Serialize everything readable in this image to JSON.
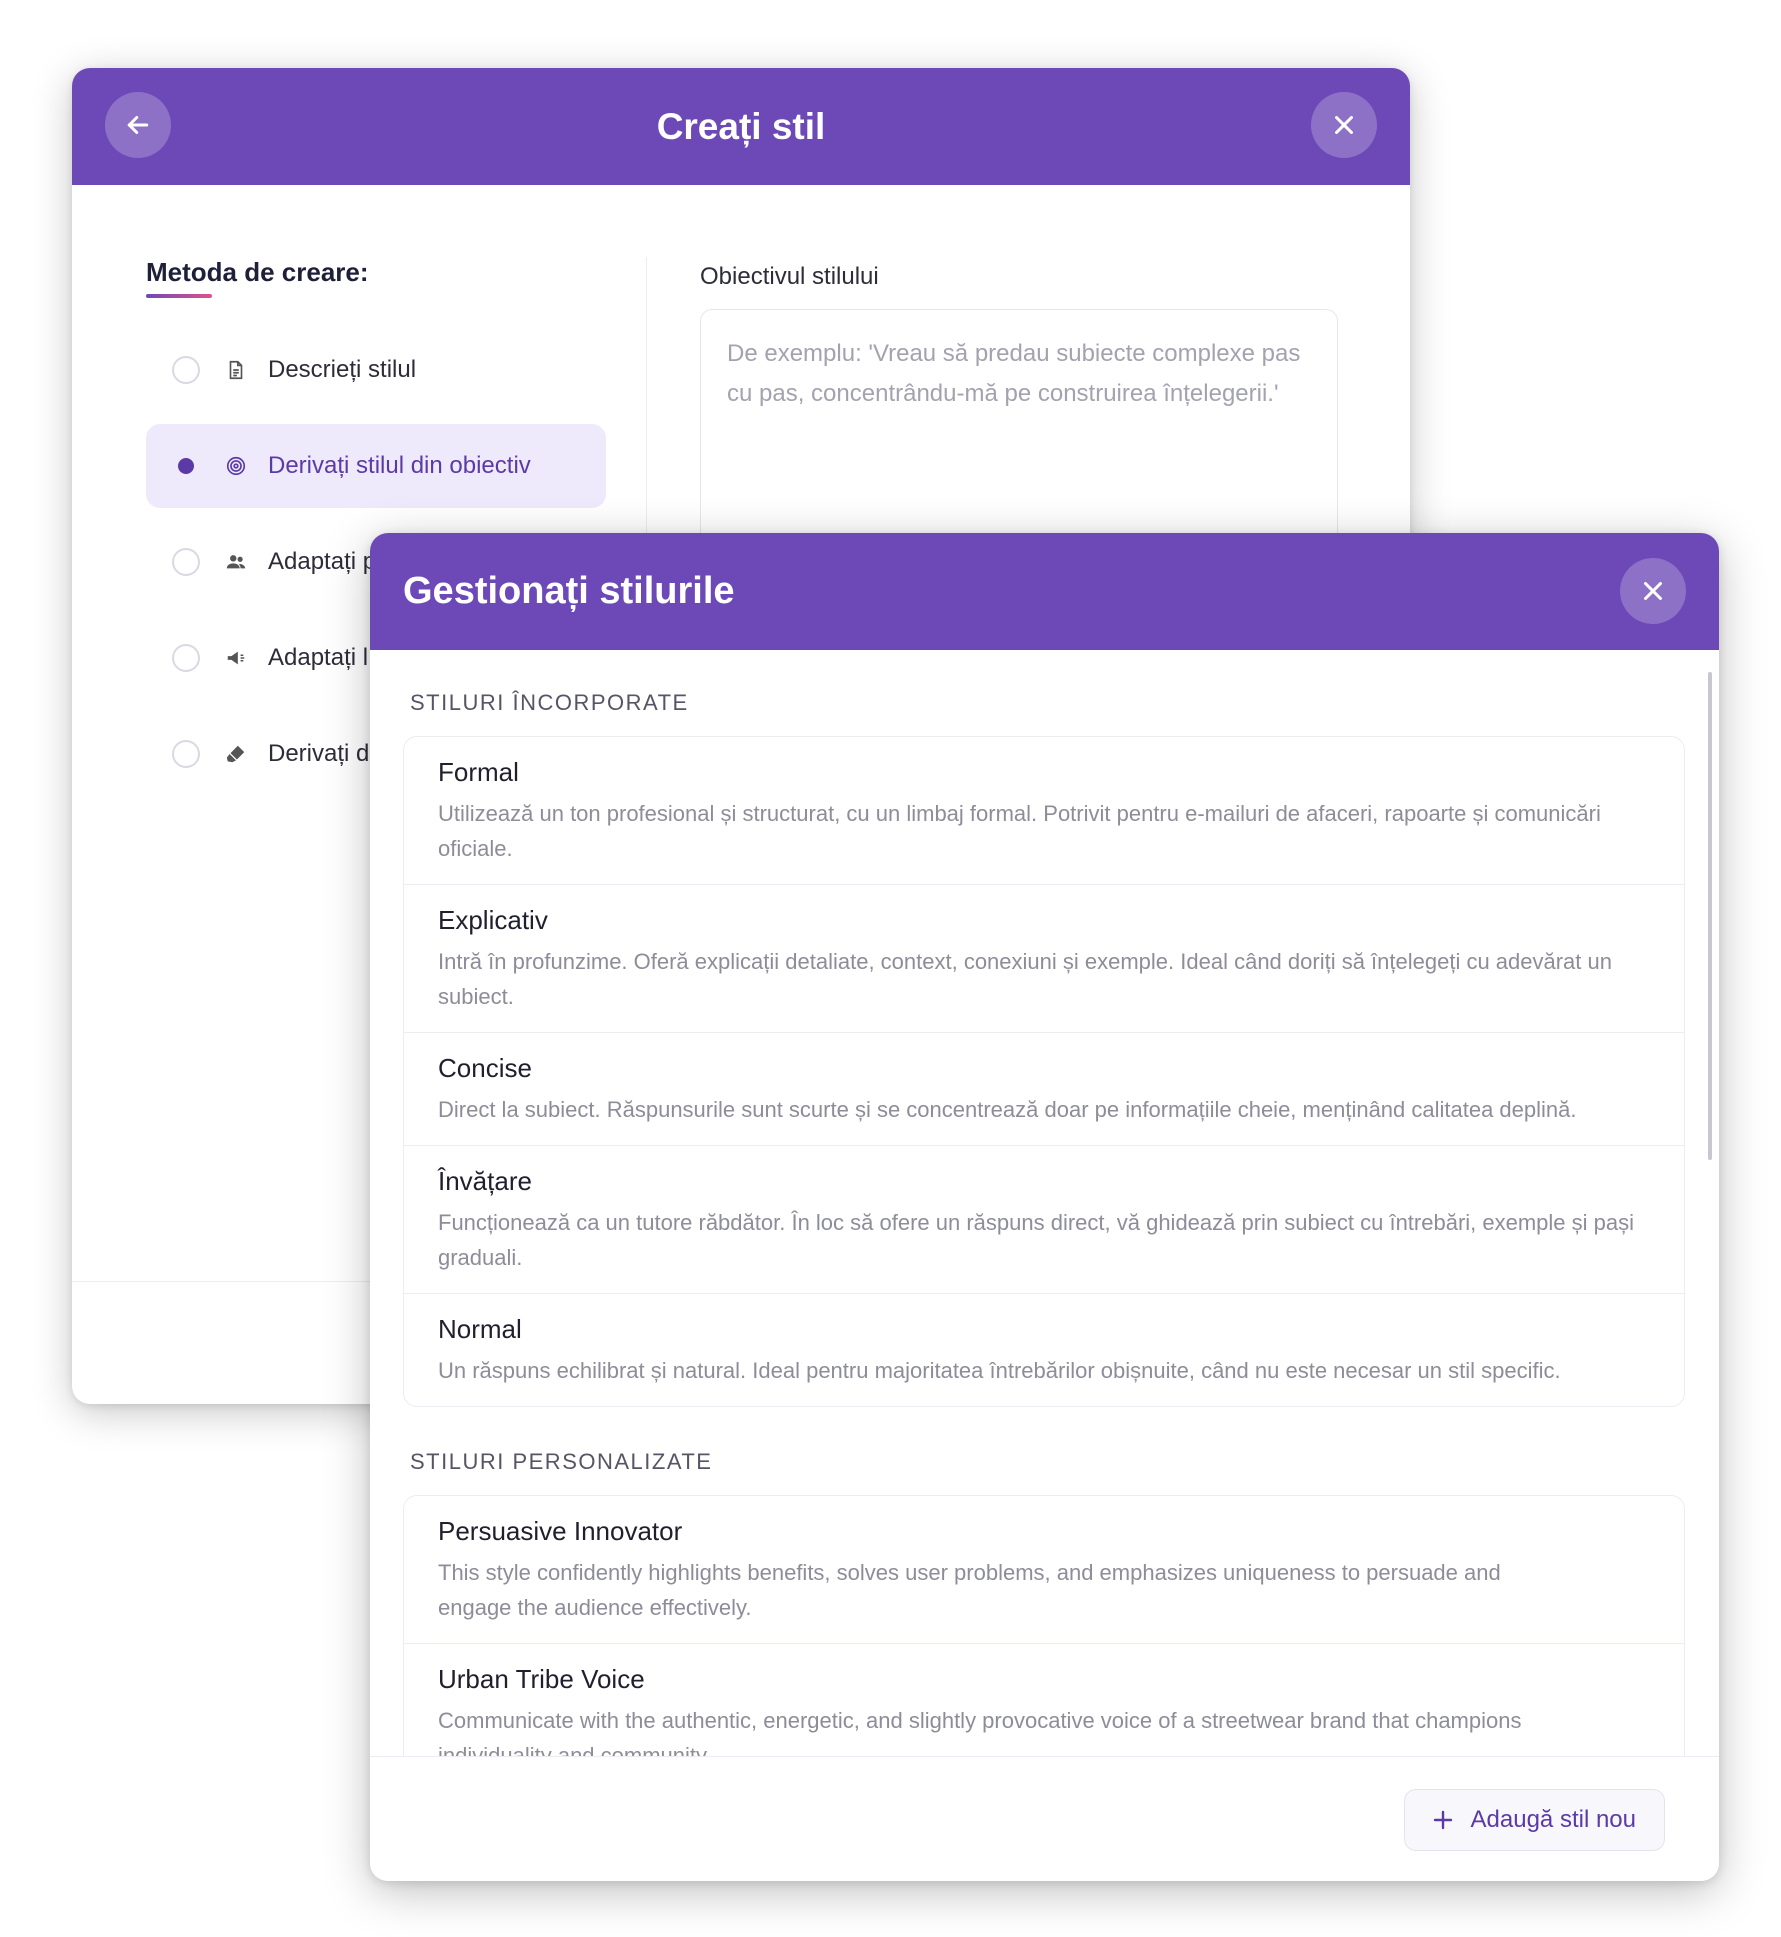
{
  "create_modal": {
    "title": "Creați stil",
    "method_label": "Metoda de creare:",
    "methods": [
      {
        "label": "Descrieți stilul",
        "icon": "document-icon",
        "selected": false
      },
      {
        "label": "Derivați stilul din obiectiv",
        "icon": "target-icon",
        "selected": true
      },
      {
        "label": "Adaptați p",
        "icon": "people-icon",
        "selected": false
      },
      {
        "label": "Adaptați l",
        "icon": "megaphone-icon",
        "selected": false
      },
      {
        "label": "Derivați d",
        "icon": "brush-icon",
        "selected": false
      }
    ],
    "goal_label": "Obiectivul stilului",
    "goal_placeholder": "De exemplu: 'Vreau să predau subiecte complexe pas cu pas, concentrându-mă pe construirea înțelegerii.'"
  },
  "manage_modal": {
    "title": "Gestionați stilurile",
    "builtin_section": "STILURI ÎNCORPORATE",
    "builtin_styles": [
      {
        "name": "Formal",
        "description": "Utilizează un ton profesional și structurat, cu un limbaj formal. Potrivit pentru e-mailuri de afaceri, rapoarte și comunicări oficiale."
      },
      {
        "name": "Explicativ",
        "description": "Intră în profunzime. Oferă explicații detaliate, context, conexiuni și exemple. Ideal când doriți să înțelegeți cu adevărat un subiect."
      },
      {
        "name": "Concise",
        "description": "Direct la subiect. Răspunsurile sunt scurte și se concentrează doar pe informațiile cheie, menținând calitatea deplină."
      },
      {
        "name": "Învățare",
        "description": "Funcționează ca un tutore răbdător. În loc să ofere un răspuns direct, vă ghidează prin subiect cu întrebări, exemple și pași graduali."
      },
      {
        "name": "Normal",
        "description": "Un răspuns echilibrat și natural. Ideal pentru majoritatea întrebărilor obișnuite, când nu este necesar un stil specific."
      }
    ],
    "custom_section": "STILURI PERSONALIZATE",
    "custom_styles": [
      {
        "name": "Persuasive Innovator",
        "description": "This style confidently highlights benefits, solves user problems, and emphasizes uniqueness to persuade and engage the audience effectively."
      },
      {
        "name": "Urban Tribe Voice",
        "description": "Communicate with the authentic, energetic, and slightly provocative voice of a streetwear brand that champions individuality and community."
      }
    ],
    "add_button": "Adaugă stil nou"
  },
  "colors": {
    "accent": "#6d49b8",
    "accent_text": "#5b3aa8",
    "selected_bg": "#efeafb"
  }
}
